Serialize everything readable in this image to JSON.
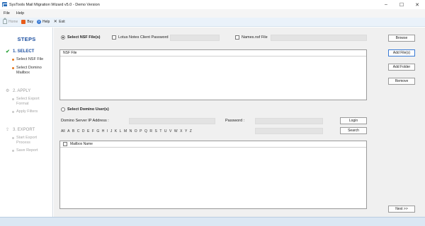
{
  "window": {
    "title": "SysTools Mail Migration Wizard v5.0 - Demo Version",
    "min_label": "–",
    "max_label": "☐",
    "close_label": "✕"
  },
  "menu": [
    "File",
    "Help"
  ],
  "toolbar": {
    "home": "Home",
    "buy": "Buy",
    "help": "Help",
    "exit": "Exit"
  },
  "steps": {
    "title": "STEPS",
    "select": {
      "label": "1. SELECT",
      "items": [
        "Select NSF File",
        "Select Domino Mailbox"
      ]
    },
    "apply": {
      "label": "2. APPLY",
      "items": [
        "Select Export Format",
        "Apply Filters"
      ]
    },
    "export": {
      "label": "3. EXPORT",
      "items": [
        "Start Export Process",
        "Save Report"
      ]
    }
  },
  "nsf": {
    "radio_label": "Select NSF File(s)",
    "notes_password_label": "Lotus Notes Client Password",
    "names_nsf_label": "Names.nsf File",
    "list_header": "NSF File",
    "browse": "Browse",
    "add_files": "Add File(s)",
    "add_folder": "Add Folder",
    "remove": "Remove"
  },
  "domino": {
    "radio_label": "Select Domino User(s)",
    "server_ip_label": "Domino Server IP Address :",
    "password_label": "Password :",
    "login": "Login",
    "search": "Search",
    "alphabet": [
      "All",
      "A",
      "B",
      "C",
      "D",
      "E",
      "F",
      "G",
      "H",
      "I",
      "J",
      "K",
      "L",
      "M",
      "N",
      "O",
      "P",
      "Q",
      "R",
      "S",
      "T",
      "U",
      "V",
      "W",
      "X",
      "Y",
      "Z"
    ],
    "list_header": "Mailbox Name"
  },
  "footer": {
    "next": "Next >>"
  }
}
